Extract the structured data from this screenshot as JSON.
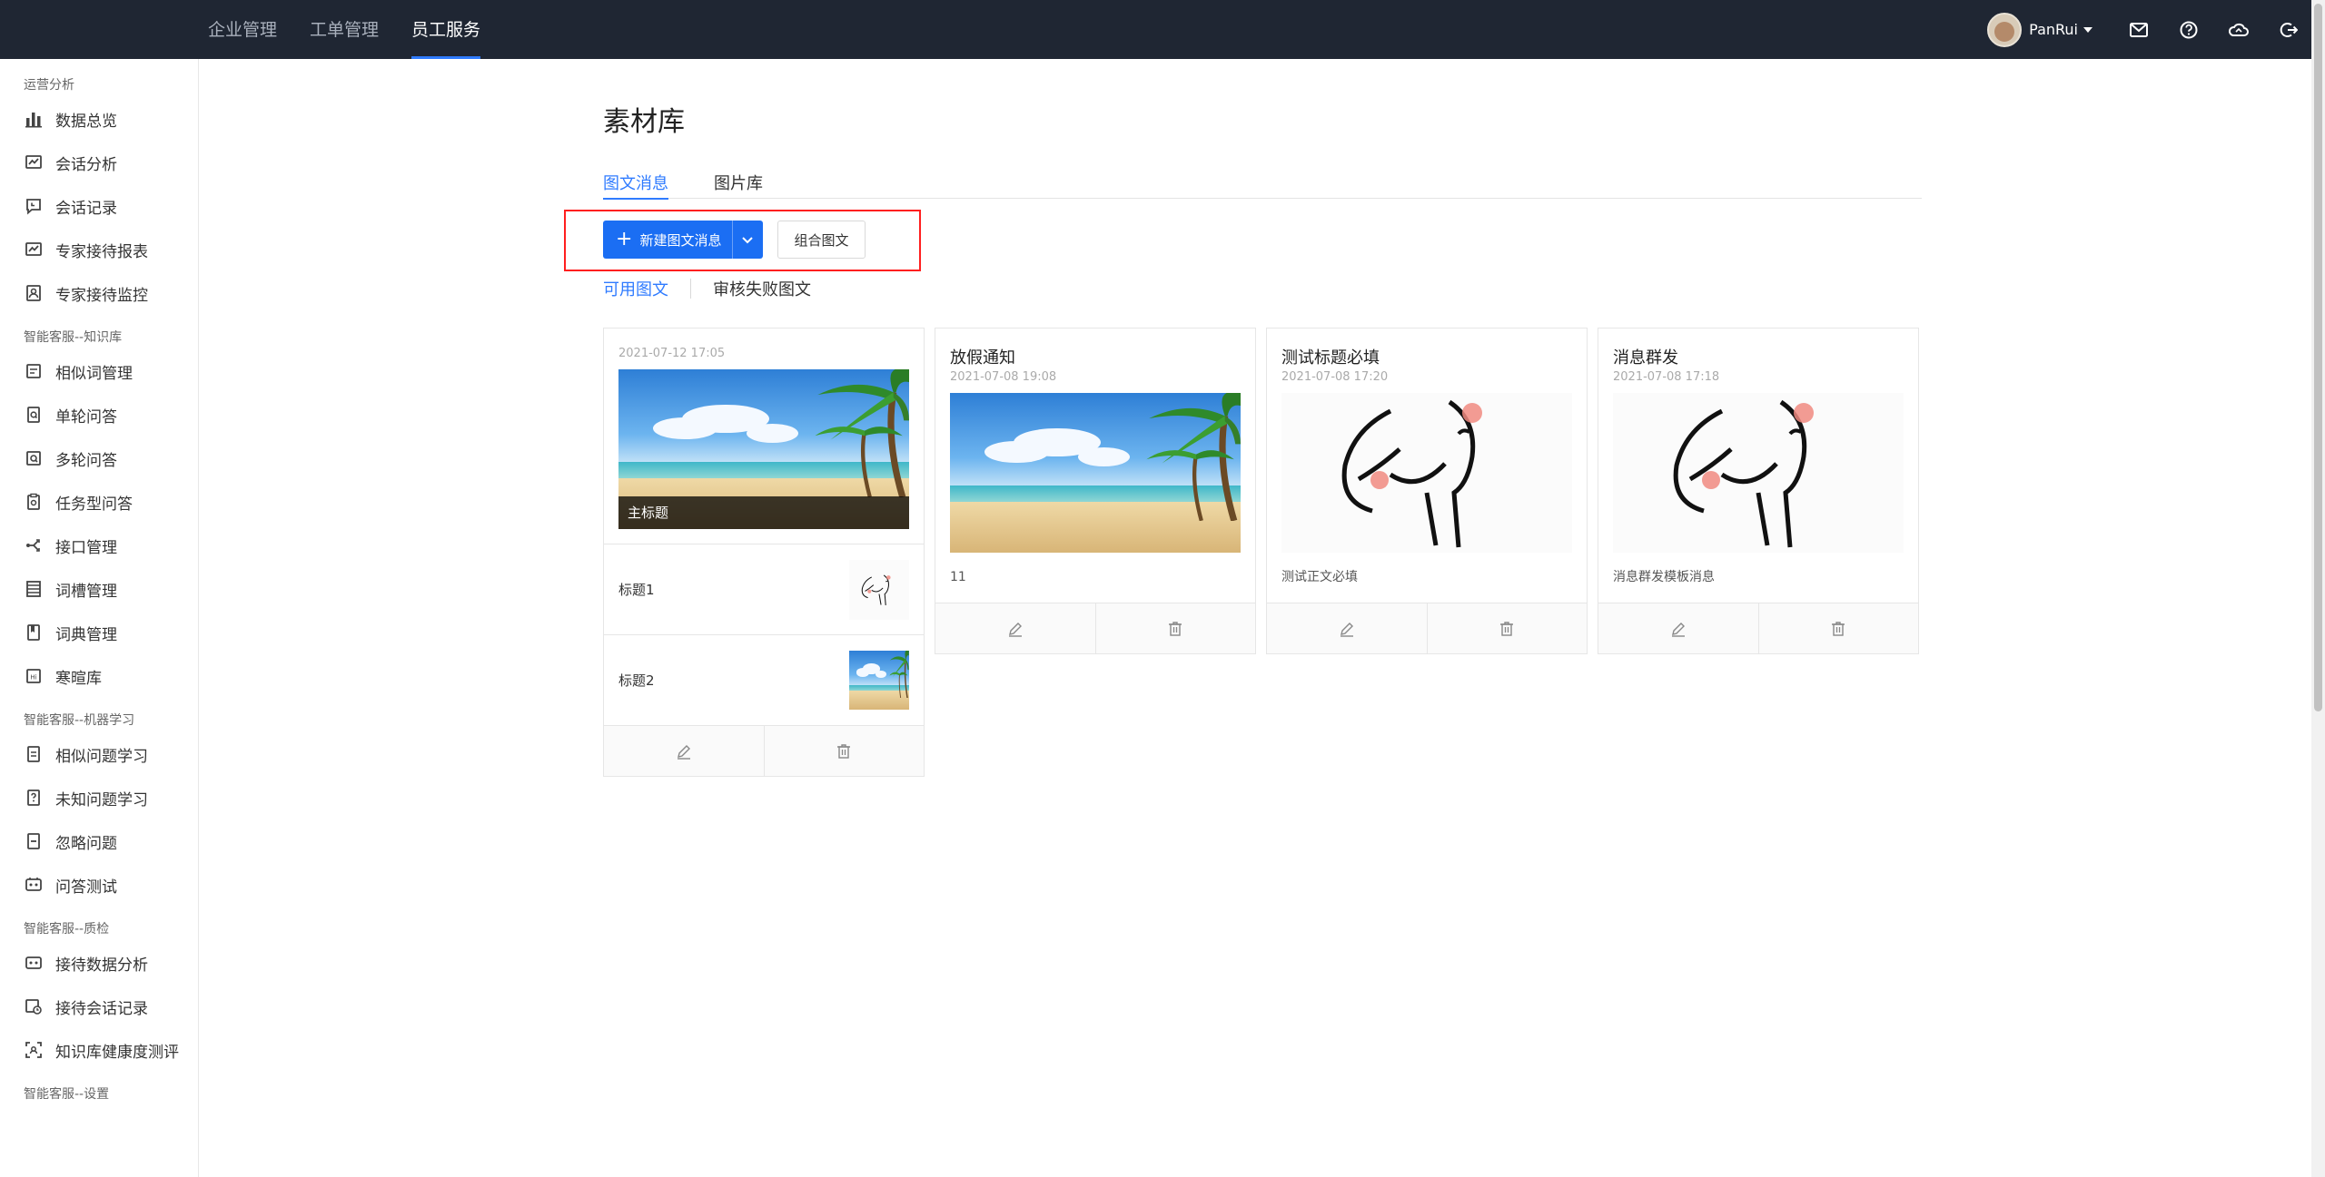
{
  "topnav": {
    "items": [
      {
        "label": "企业管理",
        "active": false
      },
      {
        "label": "工单管理",
        "active": false
      },
      {
        "label": "员工服务",
        "active": true
      }
    ]
  },
  "user": {
    "name": "PanRui"
  },
  "topicons": [
    "mail-icon",
    "help-icon",
    "cloud-icon",
    "logout-icon"
  ],
  "sidebar": {
    "groups": [
      {
        "title": "运营分析",
        "items": [
          {
            "label": "数据总览",
            "icon": "bar-chart-icon"
          },
          {
            "label": "会话分析",
            "icon": "line-chart-icon"
          },
          {
            "label": "会话记录",
            "icon": "chat-record-icon"
          },
          {
            "label": "专家接待报表",
            "icon": "line-chart-icon"
          },
          {
            "label": "专家接待监控",
            "icon": "monitor-icon"
          }
        ]
      },
      {
        "title": "智能客服--知识库",
        "items": [
          {
            "label": "相似词管理",
            "icon": "similar-word-icon"
          },
          {
            "label": "单轮问答",
            "icon": "single-qa-icon"
          },
          {
            "label": "多轮问答",
            "icon": "multi-qa-icon"
          },
          {
            "label": "任务型问答",
            "icon": "task-qa-icon"
          },
          {
            "label": "接口管理",
            "icon": "api-icon"
          },
          {
            "label": "词槽管理",
            "icon": "slot-icon"
          },
          {
            "label": "词典管理",
            "icon": "dictionary-icon"
          },
          {
            "label": "寒暄库",
            "icon": "greeting-icon"
          }
        ]
      },
      {
        "title": "智能客服--机器学习",
        "items": [
          {
            "label": "相似问题学习",
            "icon": "similar-question-icon"
          },
          {
            "label": "未知问题学习",
            "icon": "unknown-question-icon"
          },
          {
            "label": "忽略问题",
            "icon": "ignore-icon"
          },
          {
            "label": "问答测试",
            "icon": "qa-test-icon"
          }
        ]
      },
      {
        "title": "智能客服--质检",
        "items": [
          {
            "label": "接待数据分析",
            "icon": "data-analysis-icon"
          },
          {
            "label": "接待会话记录",
            "icon": "session-record-icon"
          },
          {
            "label": "知识库健康度测评",
            "icon": "health-scan-icon"
          }
        ]
      },
      {
        "title": "智能客服--设置",
        "items": []
      }
    ]
  },
  "main": {
    "title": "素材库",
    "tabs": [
      {
        "label": "图文消息",
        "active": true
      },
      {
        "label": "图片库",
        "active": false
      }
    ],
    "new_button": "新建图文消息",
    "combine_button": "组合图文",
    "subtabs": [
      {
        "label": "可用图文",
        "active": true
      },
      {
        "label": "审核失败图文",
        "active": false
      }
    ],
    "cards": [
      {
        "type": "multi",
        "date": "2021-07-12 17:05",
        "cover_caption": "主标题",
        "items": [
          {
            "title": "标题1",
            "thumb": "sketch"
          },
          {
            "title": "标题2",
            "thumb": "beach"
          }
        ]
      },
      {
        "type": "single",
        "title": "放假通知",
        "date": "2021-07-08 19:08",
        "image": "beach",
        "desc": "11"
      },
      {
        "type": "single",
        "title": "测试标题必填",
        "date": "2021-07-08 17:20",
        "image": "sketch",
        "desc": "测试正文必填"
      },
      {
        "type": "single",
        "title": "消息群发",
        "date": "2021-07-08 17:18",
        "image": "sketch",
        "desc": "消息群发模板消息"
      }
    ]
  },
  "colors": {
    "primary": "#1b6ef3",
    "topbar": "#1f2633",
    "highlight": "#ff1f1f"
  }
}
